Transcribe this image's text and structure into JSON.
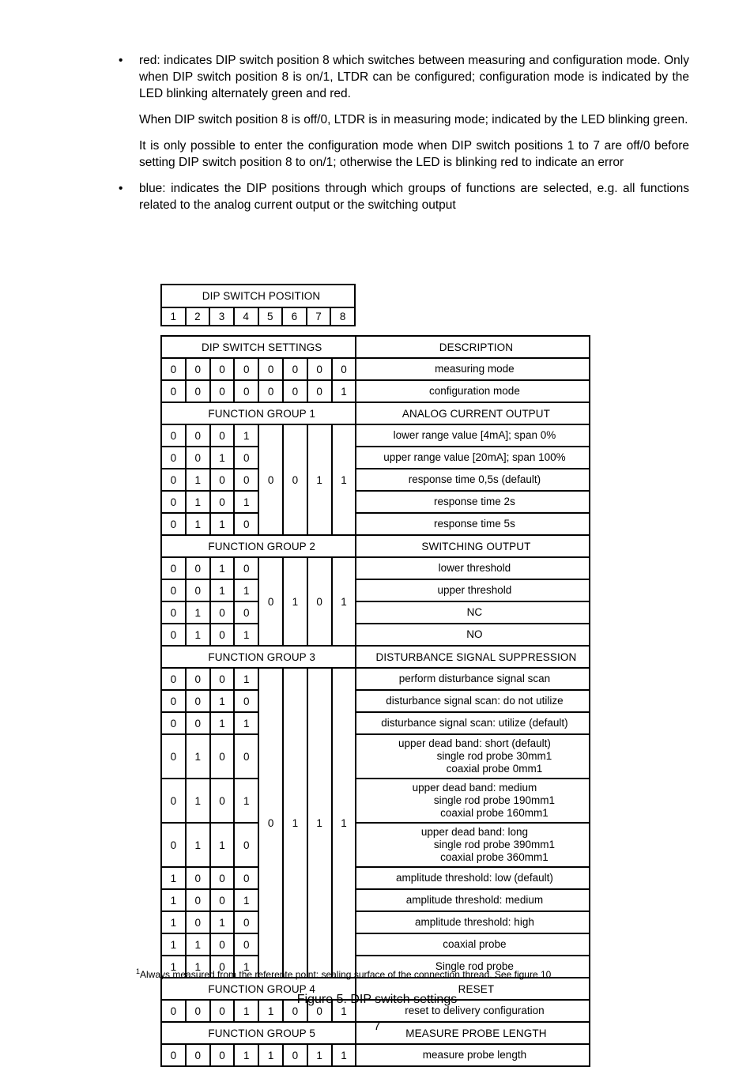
{
  "body": {
    "bullets": [
      {
        "marker": "•",
        "text": "red: indicates DIP switch position 8 which switches between measuring and configuration mode. Only when DIP switch position 8 is on/1, LTDR can be configured; configuration mode is indicated by the LED blinking alternately green and red."
      },
      {
        "marker": "•",
        "text": "blue: indicates the DIP positions through which groups of functions are selected, e.g. all functions related to the analog current output or the switching output"
      }
    ],
    "paragraph_1": "When DIP switch position 8 is off/0, LTDR is in measuring mode; indicated by the LED blinking green.",
    "paragraph_2": "It is only possible to enter the configuration mode when DIP switch positions 1 to 7 are off/0 before setting DIP switch position 8 to on/1; otherwise the LED is blinking red to indicate an error"
  },
  "dip_position_table": {
    "title": "DIP SWITCH POSITION",
    "positions": [
      {
        "label": "1",
        "color": "gray"
      },
      {
        "label": "2",
        "color": "gray"
      },
      {
        "label": "3",
        "color": "gray"
      },
      {
        "label": "4",
        "color": "gray"
      },
      {
        "label": "5",
        "color": "blue"
      },
      {
        "label": "6",
        "color": "blue"
      },
      {
        "label": "7",
        "color": "blue"
      },
      {
        "label": "8",
        "color": "red"
      }
    ]
  },
  "settings_table": {
    "header_left": "DIP SWITCH SETTINGS",
    "header_right": "DESCRIPTION",
    "mode_rows": [
      {
        "bits": [
          "0",
          "0",
          "0",
          "0",
          "0",
          "0",
          "0",
          "0"
        ],
        "description": "measuring mode"
      },
      {
        "bits": [
          "0",
          "0",
          "0",
          "0",
          "0",
          "0",
          "0",
          "1"
        ],
        "description": "configuration mode"
      }
    ],
    "groups": [
      {
        "group_label": "FUNCTION GROUP 1",
        "group_title": "ANALOG CURRENT OUTPUT",
        "group_bits": [
          "0",
          "0",
          "1",
          "1"
        ],
        "rows": [
          {
            "bits": [
              "0",
              "0",
              "0",
              "1"
            ],
            "description": "lower range value [4mA]; span 0%"
          },
          {
            "bits": [
              "0",
              "0",
              "1",
              "0"
            ],
            "description": "upper range value [20mA]; span 100%"
          },
          {
            "bits": [
              "0",
              "1",
              "0",
              "0"
            ],
            "description": "response time 0,5s (default)"
          },
          {
            "bits": [
              "0",
              "1",
              "0",
              "1"
            ],
            "description": "response time 2s"
          },
          {
            "bits": [
              "0",
              "1",
              "1",
              "0"
            ],
            "description": "response time 5s"
          }
        ]
      },
      {
        "group_label": "FUNCTION GROUP 2",
        "group_title": "SWITCHING OUTPUT",
        "group_bits": [
          "0",
          "1",
          "0",
          "1"
        ],
        "rows": [
          {
            "bits": [
              "0",
              "0",
              "1",
              "0"
            ],
            "description": "lower threshold"
          },
          {
            "bits": [
              "0",
              "0",
              "1",
              "1"
            ],
            "description": "upper threshold"
          },
          {
            "bits": [
              "0",
              "1",
              "0",
              "0"
            ],
            "description": "NC"
          },
          {
            "bits": [
              "0",
              "1",
              "0",
              "1"
            ],
            "description": "NO"
          }
        ]
      },
      {
        "group_label": "FUNCTION GROUP 3",
        "group_title": "DISTURBANCE SIGNAL SUPPRESSION",
        "group_bits": [
          "0",
          "1",
          "1",
          "1"
        ],
        "rows": [
          {
            "bits": [
              "0",
              "0",
              "0",
              "1"
            ],
            "description": "perform disturbance signal scan"
          },
          {
            "bits": [
              "0",
              "0",
              "1",
              "0"
            ],
            "description": "disturbance signal scan: do not utilize"
          },
          {
            "bits": [
              "0",
              "0",
              "1",
              "1"
            ],
            "description": "disturbance signal scan: utilize (default)"
          },
          {
            "bits": [
              "0",
              "1",
              "0",
              "0"
            ],
            "description": "upper dead band: short (default)",
            "sub_lines": [
              "single rod probe 30mm1",
              "coaxial probe 0mm1"
            ]
          },
          {
            "bits": [
              "0",
              "1",
              "0",
              "1"
            ],
            "description": "upper dead band: medium",
            "sub_lines": [
              "single rod probe 190mm1",
              "coaxial probe 160mm1"
            ]
          },
          {
            "bits": [
              "0",
              "1",
              "1",
              "0"
            ],
            "description": "upper dead band: long",
            "sub_lines": [
              "single rod probe 390mm1",
              "coaxial probe 360mm1"
            ]
          },
          {
            "bits": [
              "1",
              "0",
              "0",
              "0"
            ],
            "description": "amplitude threshold: low (default)"
          },
          {
            "bits": [
              "1",
              "0",
              "0",
              "1"
            ],
            "description": "amplitude threshold: medium"
          },
          {
            "bits": [
              "1",
              "0",
              "1",
              "0"
            ],
            "description": "amplitude threshold: high"
          },
          {
            "bits": [
              "1",
              "1",
              "0",
              "0"
            ],
            "description": "coaxial probe"
          },
          {
            "bits": [
              "1",
              "1",
              "0",
              "1"
            ],
            "description": "Single rod probe"
          }
        ]
      },
      {
        "group_label": "FUNCTION GROUP 4",
        "group_title": "RESET",
        "group_bits": [
          "1",
          "0",
          "0",
          "1"
        ],
        "inline_bits": true,
        "rows": [
          {
            "bits": [
              "0",
              "0",
              "0",
              "1"
            ],
            "description": "reset to delivery configuration"
          }
        ]
      },
      {
        "group_label": "FUNCTION GROUP 5",
        "group_title": "MEASURE PROBE LENGTH",
        "group_bits": [
          "1",
          "0",
          "1",
          "1"
        ],
        "inline_bits": true,
        "rows": [
          {
            "bits": [
              "0",
              "0",
              "0",
              "1"
            ],
            "description": "measure probe length"
          }
        ]
      }
    ]
  },
  "footnote": {
    "marker": "1",
    "text": "Always measured from the referente point: sealing surface of the connection thread. See figure 10"
  },
  "figure_caption": "Figure 5. DIP switch settings",
  "page_number": "7",
  "colors": {
    "gray_bit": "#d3d3d3",
    "blue_bit": "#93c7f0",
    "red_bit": "#ff0000",
    "border": "#000000",
    "text": "#000000"
  }
}
